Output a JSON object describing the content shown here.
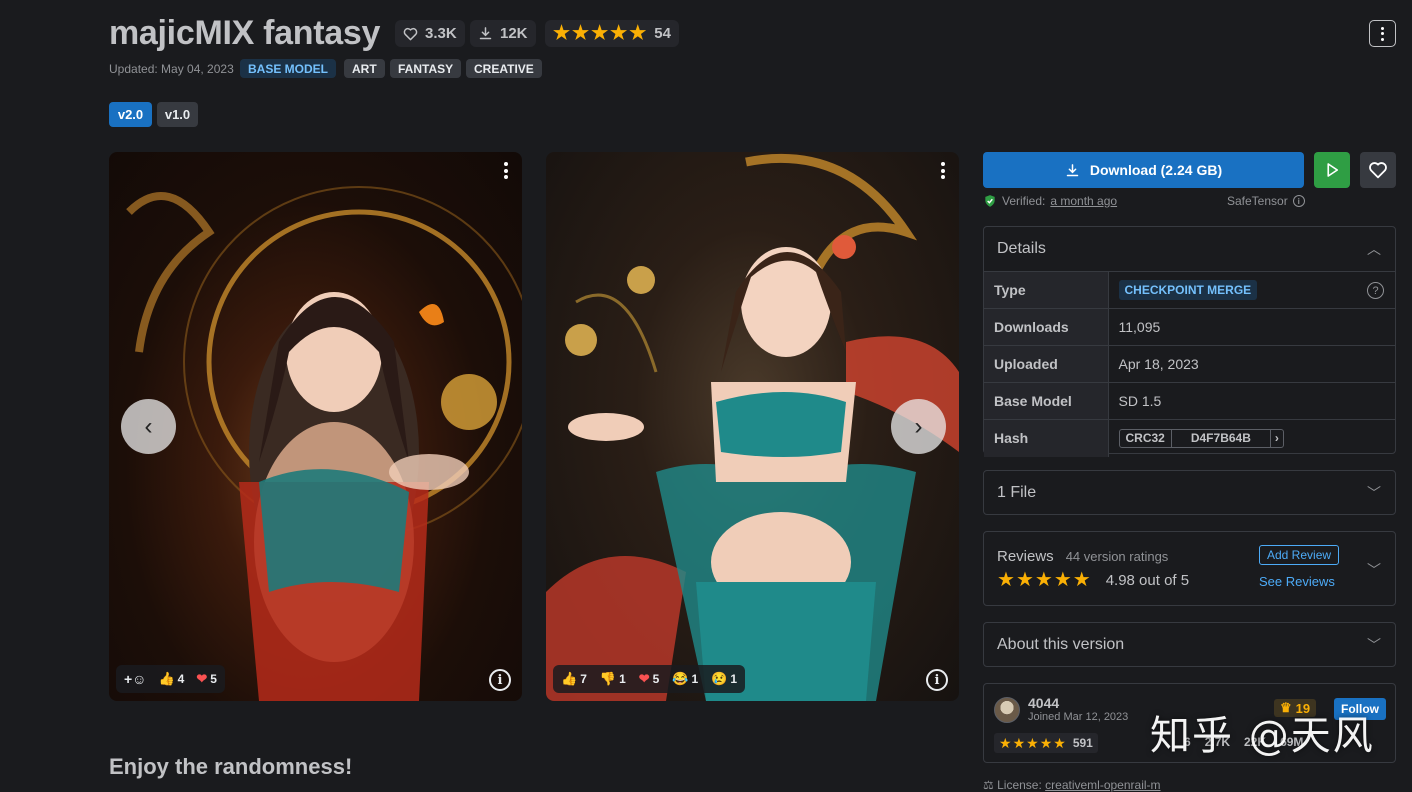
{
  "title": "majicMIX fantasy",
  "stats": {
    "likes": "3.3K",
    "downloads": "12K",
    "rating_count": "54"
  },
  "updated": "Updated: May 04, 2023",
  "tags": [
    "BASE MODEL",
    "ART",
    "FANTASY",
    "CREATIVE"
  ],
  "versions": [
    "v2.0",
    "v1.0"
  ],
  "gallery": {
    "card1": {
      "reactions": [
        {
          "emoji": "👍",
          "count": "4"
        },
        {
          "emoji": "❤️",
          "count": "5"
        }
      ]
    },
    "card2": {
      "reactions": [
        {
          "emoji": "👍",
          "count": "7"
        },
        {
          "emoji": "👎",
          "count": "1"
        },
        {
          "emoji": "❤️",
          "count": "5"
        },
        {
          "emoji": "😂",
          "count": "1"
        },
        {
          "emoji": "😢",
          "count": "1"
        }
      ]
    }
  },
  "description_heading": "Enjoy the randomness!",
  "download": {
    "label": "Download (2.24 GB)",
    "verified_label": "Verified:",
    "verified_time": "a month ago",
    "format": "SafeTensor"
  },
  "details": {
    "heading": "Details",
    "rows": [
      {
        "key": "Type",
        "value": "CHECKPOINT MERGE"
      },
      {
        "key": "Downloads",
        "value": "11,095"
      },
      {
        "key": "Uploaded",
        "value": "Apr 18, 2023"
      },
      {
        "key": "Base Model",
        "value": "SD 1.5"
      },
      {
        "key": "Hash",
        "hash_type": "CRC32",
        "value": "D4F7B64B"
      }
    ]
  },
  "files": {
    "heading": "1 File"
  },
  "reviews": {
    "heading": "Reviews",
    "count": "44 version ratings",
    "score": "4.98 out of 5",
    "add": "Add Review",
    "see": "See Reviews"
  },
  "about": {
    "heading": "About this version"
  },
  "creator": {
    "name": "4044",
    "joined": "Joined Mar 12, 2023",
    "rank": "19",
    "follow": "Follow",
    "ratings": "591",
    "uploads": "6",
    "followers": "2.7K",
    "likes": "22K",
    "downloads": "69M"
  },
  "license": {
    "label": "License:",
    "value": "creativeml-openrail-m"
  },
  "watermark": "知乎 @天风",
  "colors": {
    "accent": "#1971c2",
    "star": "#fab005",
    "green": "#2f9e44",
    "background": "#1a1b1e"
  }
}
